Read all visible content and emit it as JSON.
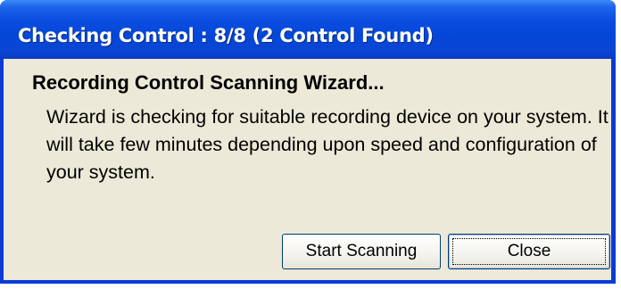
{
  "window": {
    "title": "Checking Control : 8/8 (2 Control Found)"
  },
  "content": {
    "heading": "Recording Control Scanning Wizard...",
    "description": "Wizard is checking for suitable recording device on your system. It will take few minutes depending upon speed and configuration of your system."
  },
  "buttons": {
    "start_label": "Start Scanning",
    "close_label": "Close"
  },
  "colors": {
    "titlebar": "#0447d8",
    "background": "#ece9d8",
    "button_border": "#003c74"
  }
}
